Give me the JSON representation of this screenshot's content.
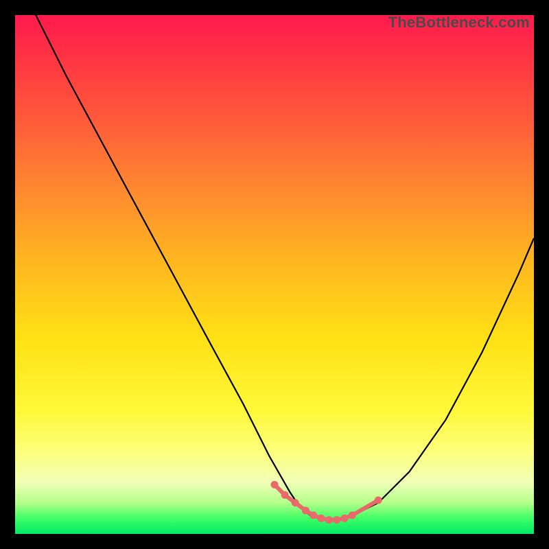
{
  "watermark": "TheBottleneck.com",
  "colors": {
    "background": "#000000",
    "curve": "#000000",
    "accent": "#e86a6a",
    "gradient_top": "#ff1a4d",
    "gradient_mid": "#ffe015",
    "gradient_bottom": "#00e865"
  },
  "chart_data": {
    "type": "line",
    "title": "",
    "xlabel": "",
    "ylabel": "",
    "xlim": [
      0,
      100
    ],
    "ylim": [
      0,
      100
    ],
    "legend": false,
    "grid": false,
    "axes_visible": false,
    "series": [
      {
        "name": "bottleneck-curve",
        "x": [
          4,
          10,
          17,
          24,
          31,
          38,
          44,
          49,
          53,
          55,
          57,
          59,
          61,
          63,
          65,
          70,
          76,
          83,
          90,
          97,
          100
        ],
        "values": [
          100,
          88,
          75,
          62,
          49,
          36,
          25,
          15,
          8,
          5,
          3.5,
          2.8,
          2.5,
          2.8,
          3.5,
          6,
          12,
          22,
          35,
          50,
          57
        ]
      }
    ],
    "accent_points": {
      "name": "valley-markers",
      "x": [
        50,
        52,
        54,
        56,
        57.5,
        59,
        60.5,
        62,
        63.5,
        65,
        70
      ],
      "values": [
        9.5,
        7.5,
        6,
        4.5,
        3.6,
        3,
        2.7,
        2.7,
        3,
        3.6,
        6.5
      ]
    }
  }
}
